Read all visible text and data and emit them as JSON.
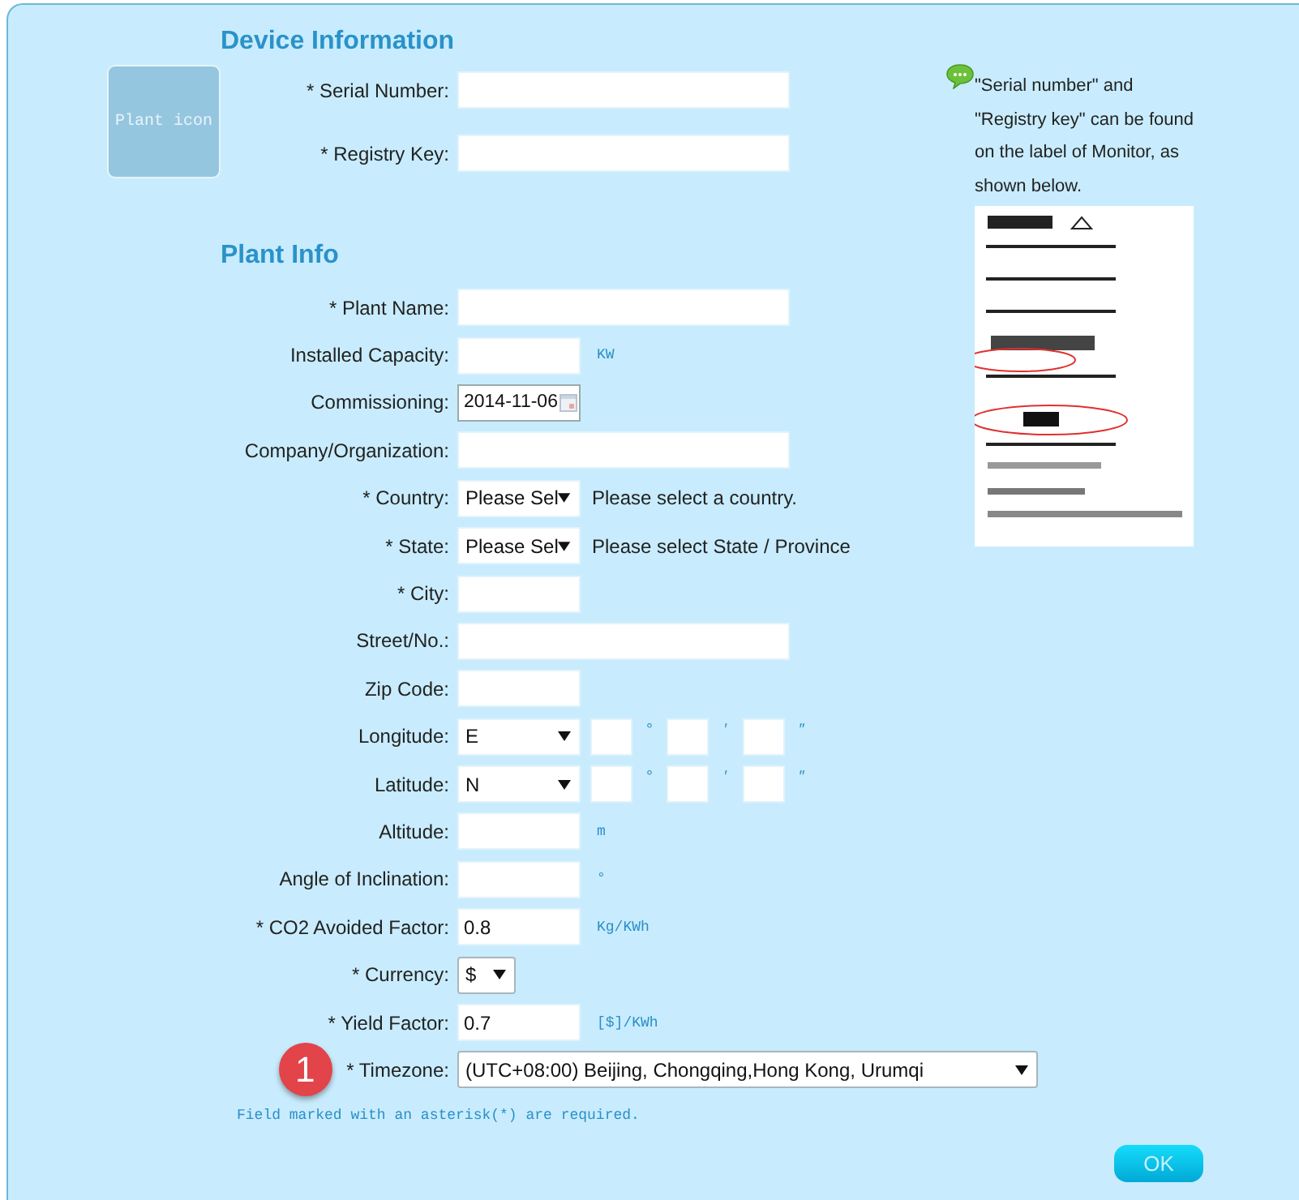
{
  "device_section": {
    "title": "Device Information",
    "plant_icon_text": "Plant icon",
    "rows": [
      {
        "kind": "wide_input",
        "label": "* Serial Number:"
      },
      {
        "kind": "wide_input",
        "label": "* Registry Key:"
      }
    ]
  },
  "note": {
    "text": "\"Serial number\" and \"Registry key\" can be found on the label of Monitor, as shown below."
  },
  "plant_section": {
    "title": "Plant Info",
    "rows": [
      {
        "kind": "wide_input",
        "label": "* Plant Name:"
      },
      {
        "kind": "short_input",
        "label": "Installed Capacity:",
        "unit": "KW"
      },
      {
        "kind": "date",
        "label": "Commissioning:",
        "value": "2014-11-06"
      },
      {
        "kind": "wide_input",
        "label": "Company/Organization:"
      },
      {
        "kind": "short_select",
        "label": "* Country:",
        "value": "Please Sel",
        "hint": "Please select a country."
      },
      {
        "kind": "short_select",
        "label": "* State:",
        "value": "Please Sel",
        "hint": "Please select State / Province"
      },
      {
        "kind": "short_input",
        "label": "* City:"
      },
      {
        "kind": "wide_input",
        "label": "Street/No.:"
      },
      {
        "kind": "short_input",
        "label": "Zip Code:"
      },
      {
        "kind": "coord",
        "label": "Longitude:",
        "value": "E",
        "parts": [
          {
            "mark": "°"
          },
          {
            "mark": "′"
          },
          {
            "mark": "″"
          }
        ]
      },
      {
        "kind": "coord",
        "label": "Latitude:",
        "value": "N",
        "parts": [
          {
            "mark": "°"
          },
          {
            "mark": "′"
          },
          {
            "mark": "″"
          }
        ]
      },
      {
        "kind": "short_input",
        "label": "Altitude:",
        "unit": "m"
      },
      {
        "kind": "short_input",
        "label": "Angle of Inclination:",
        "unit": "°"
      },
      {
        "kind": "short_input",
        "label": "* CO2 Avoided Factor:",
        "value": "0.8",
        "unit": "Kg/KWh"
      },
      {
        "kind": "tiny_select",
        "label": "* Currency:",
        "value": "$"
      },
      {
        "kind": "short_input",
        "label": "* Yield Factor:",
        "value": "0.7",
        "unit": "[$]/KWh"
      },
      {
        "kind": "long_select",
        "label": "* Timezone:",
        "value": "(UTC+08:00) Beijing, Chongqing,Hong Kong, Urumqi",
        "badge": "1"
      }
    ]
  },
  "footnote": "Field marked with an asterisk(*) are required.",
  "ok_button": "OK"
}
